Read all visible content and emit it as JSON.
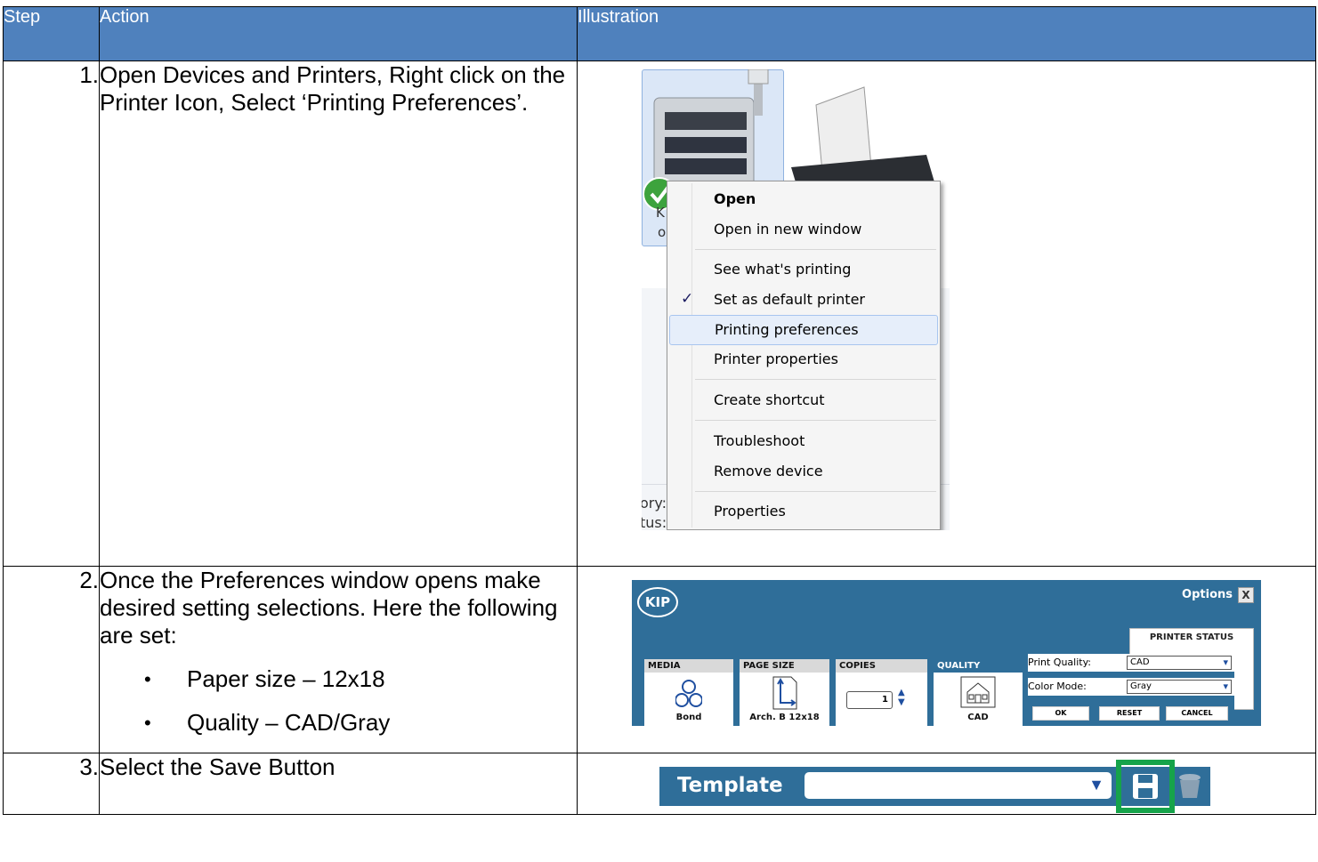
{
  "table": {
    "headers": {
      "step": "Step",
      "action": "Action",
      "illustration": "Illustration"
    },
    "rows": [
      {
        "step": "1.",
        "action": "Open Devices and Printers, Right click on the Printer Icon, Select ‘Printing Preferences’."
      },
      {
        "step": "2.",
        "action": "Once the Preferences window opens make desired setting selections. Here the following are set:",
        "bullets": [
          "Paper size – 12x18",
          "Quality – CAD/Gray"
        ]
      },
      {
        "step": "3.",
        "action": "Select the Save Button"
      }
    ]
  },
  "context_menu": {
    "items": [
      "Open",
      "Open in new window",
      "See what's printing",
      "Set as default printer",
      "Printing preferences",
      "Printer properties",
      "Create shortcut",
      "Troubleshoot",
      "Remove device",
      "Properties"
    ],
    "checked_item": "Set as default printer",
    "highlighted_item": "Printing preferences",
    "printer_label_fragments": [
      "K",
      "o"
    ],
    "cut_labels": [
      "ory:",
      "tus:"
    ]
  },
  "kip": {
    "logo": "KIP",
    "title": "Options",
    "close": "X",
    "printer_status": "PRINTER STATUS",
    "panels": {
      "media": {
        "header": "MEDIA",
        "label": "Bond"
      },
      "page_size": {
        "header": "PAGE SIZE",
        "label": "Arch. B 12x18"
      },
      "copies": {
        "header": "COPIES",
        "value": "1"
      },
      "quality": {
        "header": "QUALITY",
        "label": "CAD"
      }
    },
    "print_quality_label": "Print Quality:",
    "print_quality_value": "CAD",
    "color_mode_label": "Color Mode:",
    "color_mode_value": "Gray",
    "buttons": {
      "ok": "OK",
      "reset": "RESET",
      "cancel": "CANCEL"
    }
  },
  "template_bar": {
    "label": "Template",
    "selected": ""
  },
  "colors": {
    "header_bg": "#4f81bd",
    "kip_blue": "#2f6e99",
    "highlight_green": "#16a34a"
  }
}
